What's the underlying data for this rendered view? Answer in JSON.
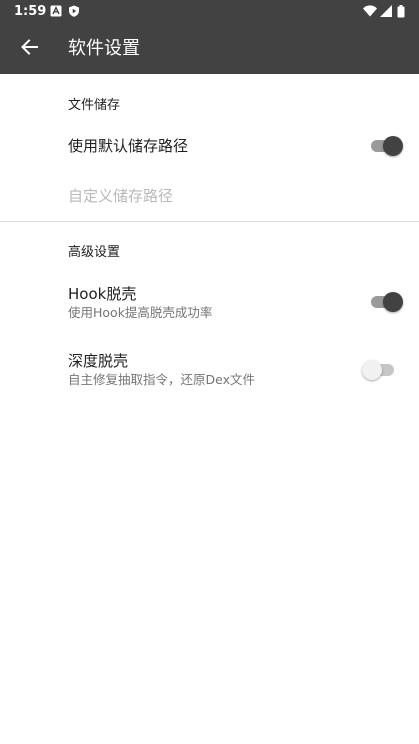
{
  "status_bar": {
    "time": "1:59",
    "icons": [
      "notification-a-icon",
      "play-shield-icon",
      "wifi-icon",
      "signal-icon",
      "battery-icon"
    ]
  },
  "app_bar": {
    "back_icon": "arrow-back-icon",
    "title": "软件设置"
  },
  "sections": {
    "storage": {
      "title": "文件储存",
      "default_path": {
        "title": "使用默认储存路径",
        "enabled": true
      },
      "custom_path": {
        "title": "自定义储存路径",
        "disabled": true
      }
    },
    "advanced": {
      "title": "高级设置",
      "hook_unpack": {
        "title": "Hook脱壳",
        "summary": "使用Hook提高脱壳成功率",
        "enabled": true
      },
      "deep_unpack": {
        "title": "深度脱壳",
        "summary": "自主修复抽取指令，还原Dex文件",
        "enabled": false
      }
    }
  },
  "colors": {
    "app_bar": "#424242",
    "switch_on_thumb": "#424242",
    "switch_on_track": "#9a9a9a",
    "switch_off_thumb": "#f1f1f1",
    "switch_off_track": "#c6c6c6",
    "disabled_text": "#b9b9b9"
  }
}
